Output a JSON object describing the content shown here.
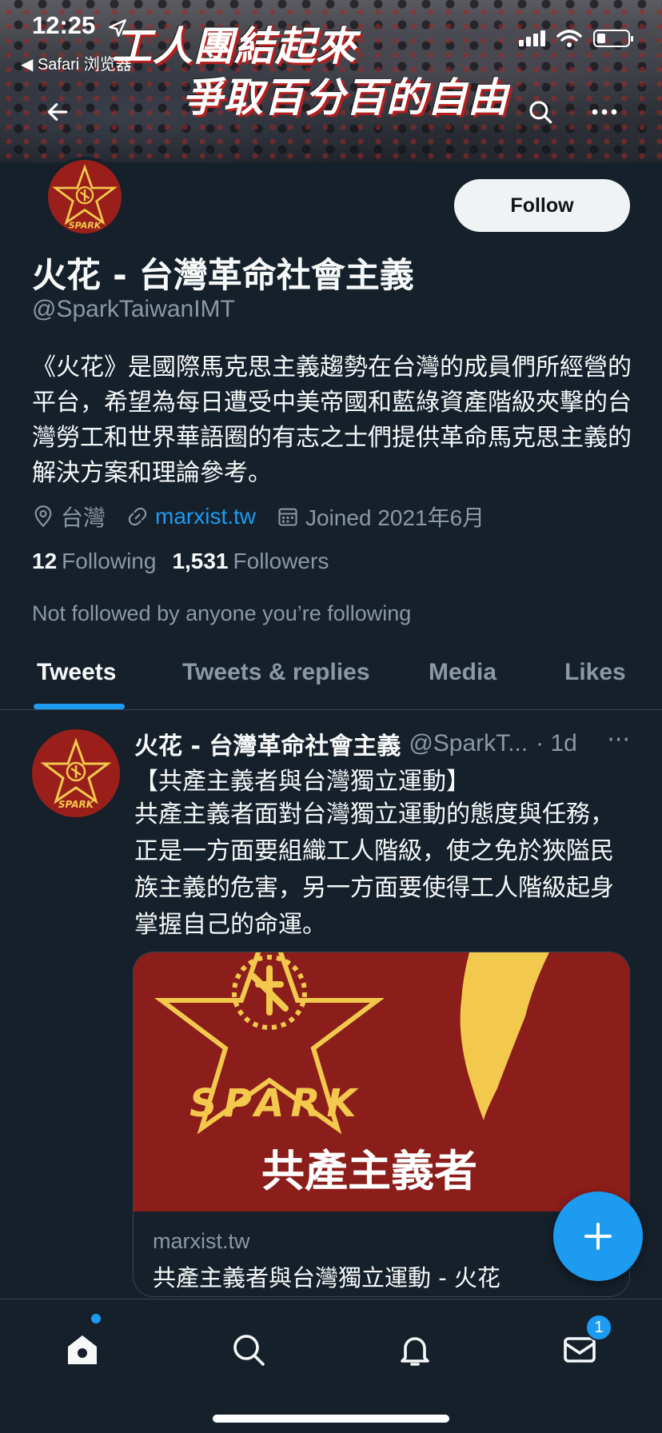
{
  "status_bar": {
    "time": "12:25",
    "back_app": "◀ Safari 浏览器"
  },
  "banner": {
    "slogan_line1": "工人團結起來",
    "slogan_line2": "爭取百分百的自由"
  },
  "profile": {
    "avatar_text": "SPARK",
    "name": "火花 - 台灣革命社會主義",
    "handle": "@SparkTaiwanIMT",
    "follow_label": "Follow",
    "bio": "《火花》是國際馬克思主義趨勢在台灣的成員們所經營的平台，希望為每日遭受中美帝國和藍綠資產階級夾擊的台灣勞工和世界華語圈的有志之士們提供革命馬克思主義的解決方案和理論參考。",
    "location": "台灣",
    "website": "marxist.tw",
    "joined": "Joined 2021年6月",
    "following_count": "12",
    "following_label": "Following",
    "followers_count": "1,531",
    "followers_label": "Followers",
    "not_followed": "Not followed by anyone you’re following"
  },
  "tabs": [
    {
      "label": "Tweets",
      "active": true
    },
    {
      "label": "Tweets & replies",
      "active": false
    },
    {
      "label": "Media",
      "active": false
    },
    {
      "label": "Likes",
      "active": false
    }
  ],
  "tweet": {
    "author": "火花 - 台灣革命社會主義",
    "handle": "@SparkT...",
    "time": "· 1d",
    "more": "···",
    "title": "【共產主義者與台灣獨立運動】",
    "body": "共產主義者面對台灣獨立運動的態度與任務，正是一方面要組織工人階級，使之免於狹隘民族主義的危害，另一方面要使得工人階級起身掌握自己的命運。",
    "card": {
      "image_logo_text": "SPARK",
      "image_caption": "共產主義者",
      "domain": "marxist.tw",
      "title": "共產主義者與台灣獨立運動 - 火花"
    }
  },
  "bottom_nav": {
    "items": [
      "home-icon",
      "search-icon",
      "bell-icon",
      "mail-icon"
    ],
    "messages_badge": "1"
  },
  "colors": {
    "background": "#15202b",
    "accent": "#1d9bf0",
    "secondary_text": "#8b98a5",
    "brand_red": "#9a1f1a",
    "brand_yellow": "#f2c94c"
  }
}
